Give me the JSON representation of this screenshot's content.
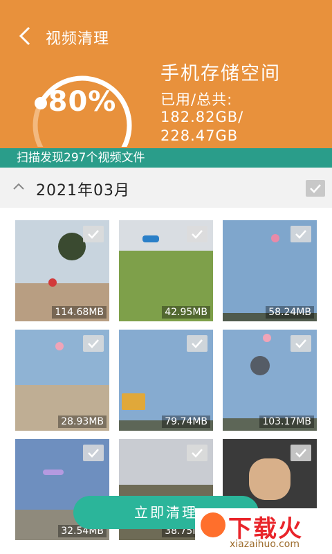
{
  "header": {
    "title": "视频清理",
    "percent": "80%",
    "usage_fraction": 0.8,
    "storage_title": "手机存储空间",
    "storage_label": "已用/总共:",
    "used": "182.82GB/",
    "total": "228.47GB"
  },
  "scan_summary": "扫描发现297个视频文件",
  "group": {
    "title": "2021年03月",
    "checked": true
  },
  "videos": [
    {
      "size": "114.68MB"
    },
    {
      "size": "42.95MB"
    },
    {
      "size": "58.24MB"
    },
    {
      "size": "28.93MB"
    },
    {
      "size": "79.74MB"
    },
    {
      "size": "103.17MB"
    },
    {
      "size": "32.54MB"
    },
    {
      "size": "38.75MB"
    },
    {
      "size": ""
    }
  ],
  "clean_button": "立即清理",
  "watermark": {
    "text": "下载火",
    "url": "xiazaihuo.com"
  },
  "colors": {
    "header": "#e8913c",
    "scan_bar": "#2a9d8a",
    "button": "#2bb59a"
  }
}
